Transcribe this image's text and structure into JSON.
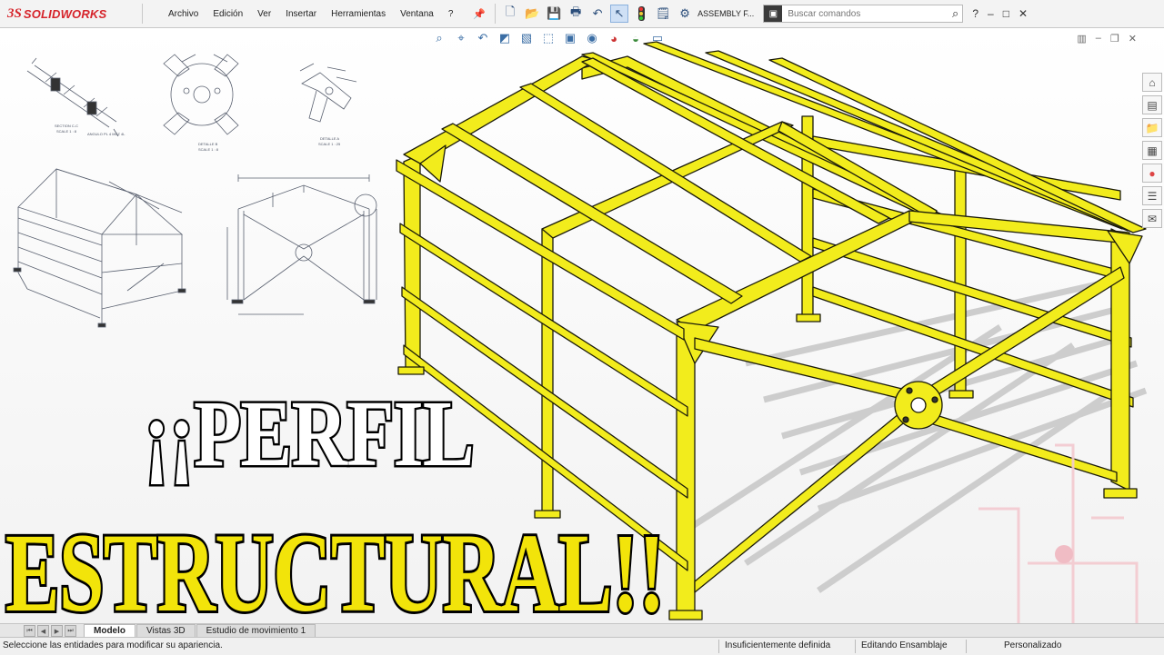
{
  "app": {
    "logo_prefix": "3S",
    "logo_name": "SOLIDWORKS"
  },
  "menu": [
    "Archivo",
    "Edición",
    "Ver",
    "Insertar",
    "Herramientas",
    "Ventana",
    "?"
  ],
  "document_title": "ASSEMBLY F...",
  "search": {
    "placeholder": "Buscar comandos"
  },
  "overlay": {
    "line1": "¡¡PERFIL",
    "line2": "ESTRUCTURAL!!"
  },
  "drawing_labels": {
    "section_c": "SECTION C-C",
    "section_c_scale": "SCALE 1 : 8",
    "section_c_note": "ANGULO PL 4 MCZ 4L",
    "detail_b": "DETALLE B",
    "detail_b_scale": "SCALE 1 : 8",
    "detail_a": "DETALLE A",
    "detail_a_scale": "SCALE 1 : 25"
  },
  "tabs": [
    {
      "label": "Modelo",
      "active": true
    },
    {
      "label": "Vistas 3D",
      "active": false
    },
    {
      "label": "Estudio de movimiento 1",
      "active": false
    }
  ],
  "status": {
    "message": "Seleccione las entidades para modificar su apariencia.",
    "definition": "Insuficientemente definida",
    "mode": "Editando Ensamblaje",
    "units": "Personalizado"
  },
  "colors": {
    "steel": "#f2ec1c",
    "brand_red": "#d6242b",
    "title_yellow": "#f2e40a"
  },
  "icons": [
    "home-icon",
    "parts-icon",
    "folder-icon",
    "view-palette-icon",
    "appearance-icon",
    "custom-properties-icon",
    "forum-icon"
  ]
}
